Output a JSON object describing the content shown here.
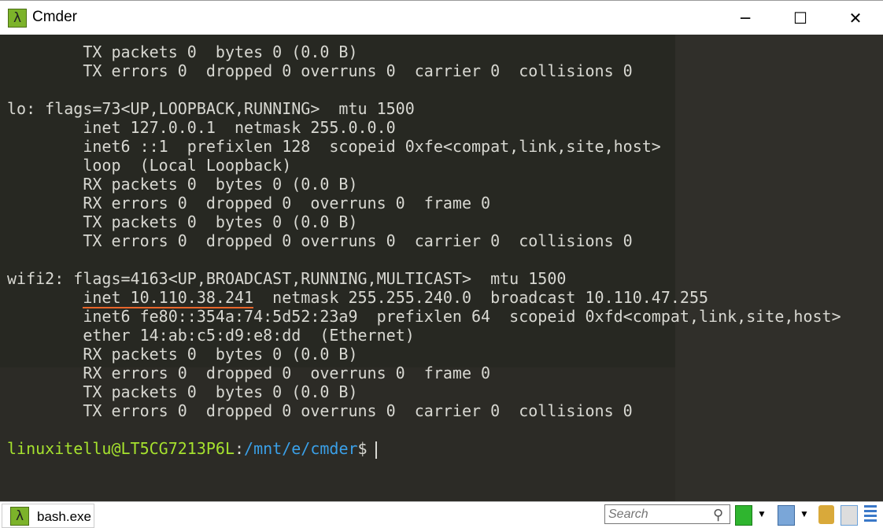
{
  "window": {
    "title": "Cmder",
    "minimize": "─",
    "maximize": "☐",
    "close": "✕"
  },
  "terminal": {
    "lines": [
      "        TX packets 0  bytes 0 (0.0 B)",
      "        TX errors 0  dropped 0 overruns 0  carrier 0  collisions 0",
      "",
      "lo: flags=73<UP,LOOPBACK,RUNNING>  mtu 1500",
      "        inet 127.0.0.1  netmask 255.0.0.0",
      "        inet6 ::1  prefixlen 128  scopeid 0xfe<compat,link,site,host>",
      "        loop  (Local Loopback)",
      "        RX packets 0  bytes 0 (0.0 B)",
      "        RX errors 0  dropped 0  overruns 0  frame 0",
      "        TX packets 0  bytes 0 (0.0 B)",
      "        TX errors 0  dropped 0 overruns 0  carrier 0  collisions 0",
      "",
      "wifi2: flags=4163<UP,BROADCAST,RUNNING,MULTICAST>  mtu 1500",
      "",
      "        inet6 fe80::354a:74:5d52:23a9  prefixlen 64  scopeid 0xfd<compat,link,site,host>",
      "        ether 14:ab:c5:d9:e8:dd  (Ethernet)",
      "        RX packets 0  bytes 0 (0.0 B)",
      "        RX errors 0  dropped 0  overruns 0  frame 0",
      "        TX packets 0  bytes 0 (0.0 B)",
      "        TX errors 0  dropped 0 overruns 0  carrier 0  collisions 0",
      ""
    ],
    "highlight_inet": "inet 10.110.38.241",
    "highlight_rest": "  netmask 255.255.240.0  broadcast 10.110.47.255",
    "prompt": {
      "user": "linuxitellu@LT5CG7213P6L",
      "sep": ":",
      "path": "/mnt/e/cmder",
      "symbol": "$"
    }
  },
  "statusbar": {
    "tab_label": "bash.exe",
    "search_placeholder": "Search"
  },
  "colors": {
    "background": "#272822",
    "prompt_user": "#a6e22e",
    "prompt_path": "#3aa0e8",
    "underline": "#e8652b",
    "lambda_icon": "#7cb32a"
  }
}
